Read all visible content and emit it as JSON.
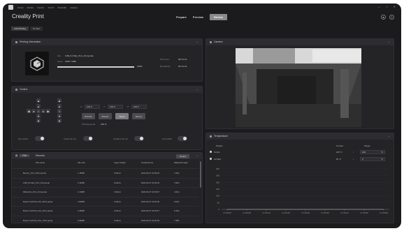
{
  "menubar": {
    "items": [
      "File(F)",
      "Edit(E)",
      "View(V)",
      "Tool(T)",
      "Model(M)",
      "Help(H)"
    ]
  },
  "window_controls": {
    "minimize": "—",
    "maximize": "□",
    "close": "✕"
  },
  "app": {
    "title": "Creality Print"
  },
  "modes": {
    "prepare": "Prepare",
    "preview": "Preview",
    "device": "Device"
  },
  "subtabs": [
    "LAN Printing",
    "K1 Max"
  ],
  "printing_info": {
    "title": "Printing Information",
    "file_label": "File:",
    "file_value": "U4B_K1 Max_PLA_1h4.gcode",
    "layer_label": "Layer:",
    "layer_value": "1845 / 1845",
    "progress_text": "100%",
    "progress": 1.0,
    "print_time_label": "Print time:",
    "print_time_value": "08 hrs 6s",
    "remaining_label": "Remaining:",
    "remaining_value": "00 hrs 0s"
  },
  "camera": {
    "title": "Camera"
  },
  "control": {
    "title": "Control",
    "x_label": "X:",
    "x_value": "100.0",
    "y_label": "Y:",
    "y_value": "100.0",
    "z_label": "Z:",
    "z_value": "106.0",
    "buttons": [
      "Extrude",
      "Retract",
      "Home",
      "Motors"
    ],
    "speed_label": "Printing speed:",
    "speed_value": "100 %",
    "model_fan": "Fan switch",
    "cavity_fan": "Cavity fan sw",
    "auxiliary_fan": "Auxiliary fan sw",
    "led": "Led switch"
  },
  "files": {
    "tab_file": "File",
    "tab_records": "Records",
    "export": "Export",
    "headers": [
      "File name",
      "File size",
      "Layer height",
      "Created time",
      "Material length"
    ],
    "rows": [
      [
        "Benchy_PLA_35m4.gcode",
        "1.15MB",
        "0.20mm",
        "2023-09-27 10:09:23",
        "7.05m"
      ],
      [
        "U4B_K1 Max_PLA_1h4.gcode",
        "3.12MB",
        "0.20mm",
        "2023-09-27 15:03:34",
        "7.82m"
      ],
      [
        "3Dbenchy_PLA_1h4.gcode",
        "2.13MB",
        "0.20mm",
        "2023-09-27 10:03:07",
        "4.02m"
      ],
      [
        "Boston Swift 64_PLA_9h41.gcode",
        "4.09MB",
        "0.20mm",
        "2023-09-27 15:03:02",
        "9.04m"
      ],
      [
        "Boston Swift 64_PLA_4h14.gcode",
        "3.36MB",
        "0.20mm",
        "2023-09-27 15:02:57",
        "6.30m"
      ],
      [
        "Boston Swift 64_PLA_7h16.gcode",
        "3.96MB",
        "0.20mm",
        "2023-09-27 15:02:53",
        "7.38m"
      ]
    ]
  },
  "temperature": {
    "title": "Temperature",
    "col_project": "Project",
    "col_current": "Current",
    "col_target": "Target",
    "nozzle_label": "Nozzle",
    "nozzle_current": "206 °C",
    "nozzle_target": "200",
    "hotbed_label": "Hot Bed",
    "hotbed_current": "60 °C",
    "hotbed_target": "0",
    "slash": "/",
    "unit": "°C"
  },
  "chart_data": {
    "type": "line",
    "x": [
      "17:29:00",
      "17:29:08",
      "17:29:13",
      "17:29:20",
      "17:29:28",
      "17:29:35",
      "17:29:43",
      "17:29:50",
      "17:29:58"
    ],
    "ylim": [
      0,
      300
    ],
    "yticks": [
      "300",
      "250",
      "200",
      "150",
      "100",
      "50",
      "0"
    ],
    "series": [
      {
        "values": [
          0,
          0,
          0,
          0,
          0,
          0,
          0,
          0,
          0
        ]
      }
    ]
  },
  "colors": {
    "background": "#1b1b1d",
    "panel": "#242427",
    "accent": "#8a8a8a"
  }
}
